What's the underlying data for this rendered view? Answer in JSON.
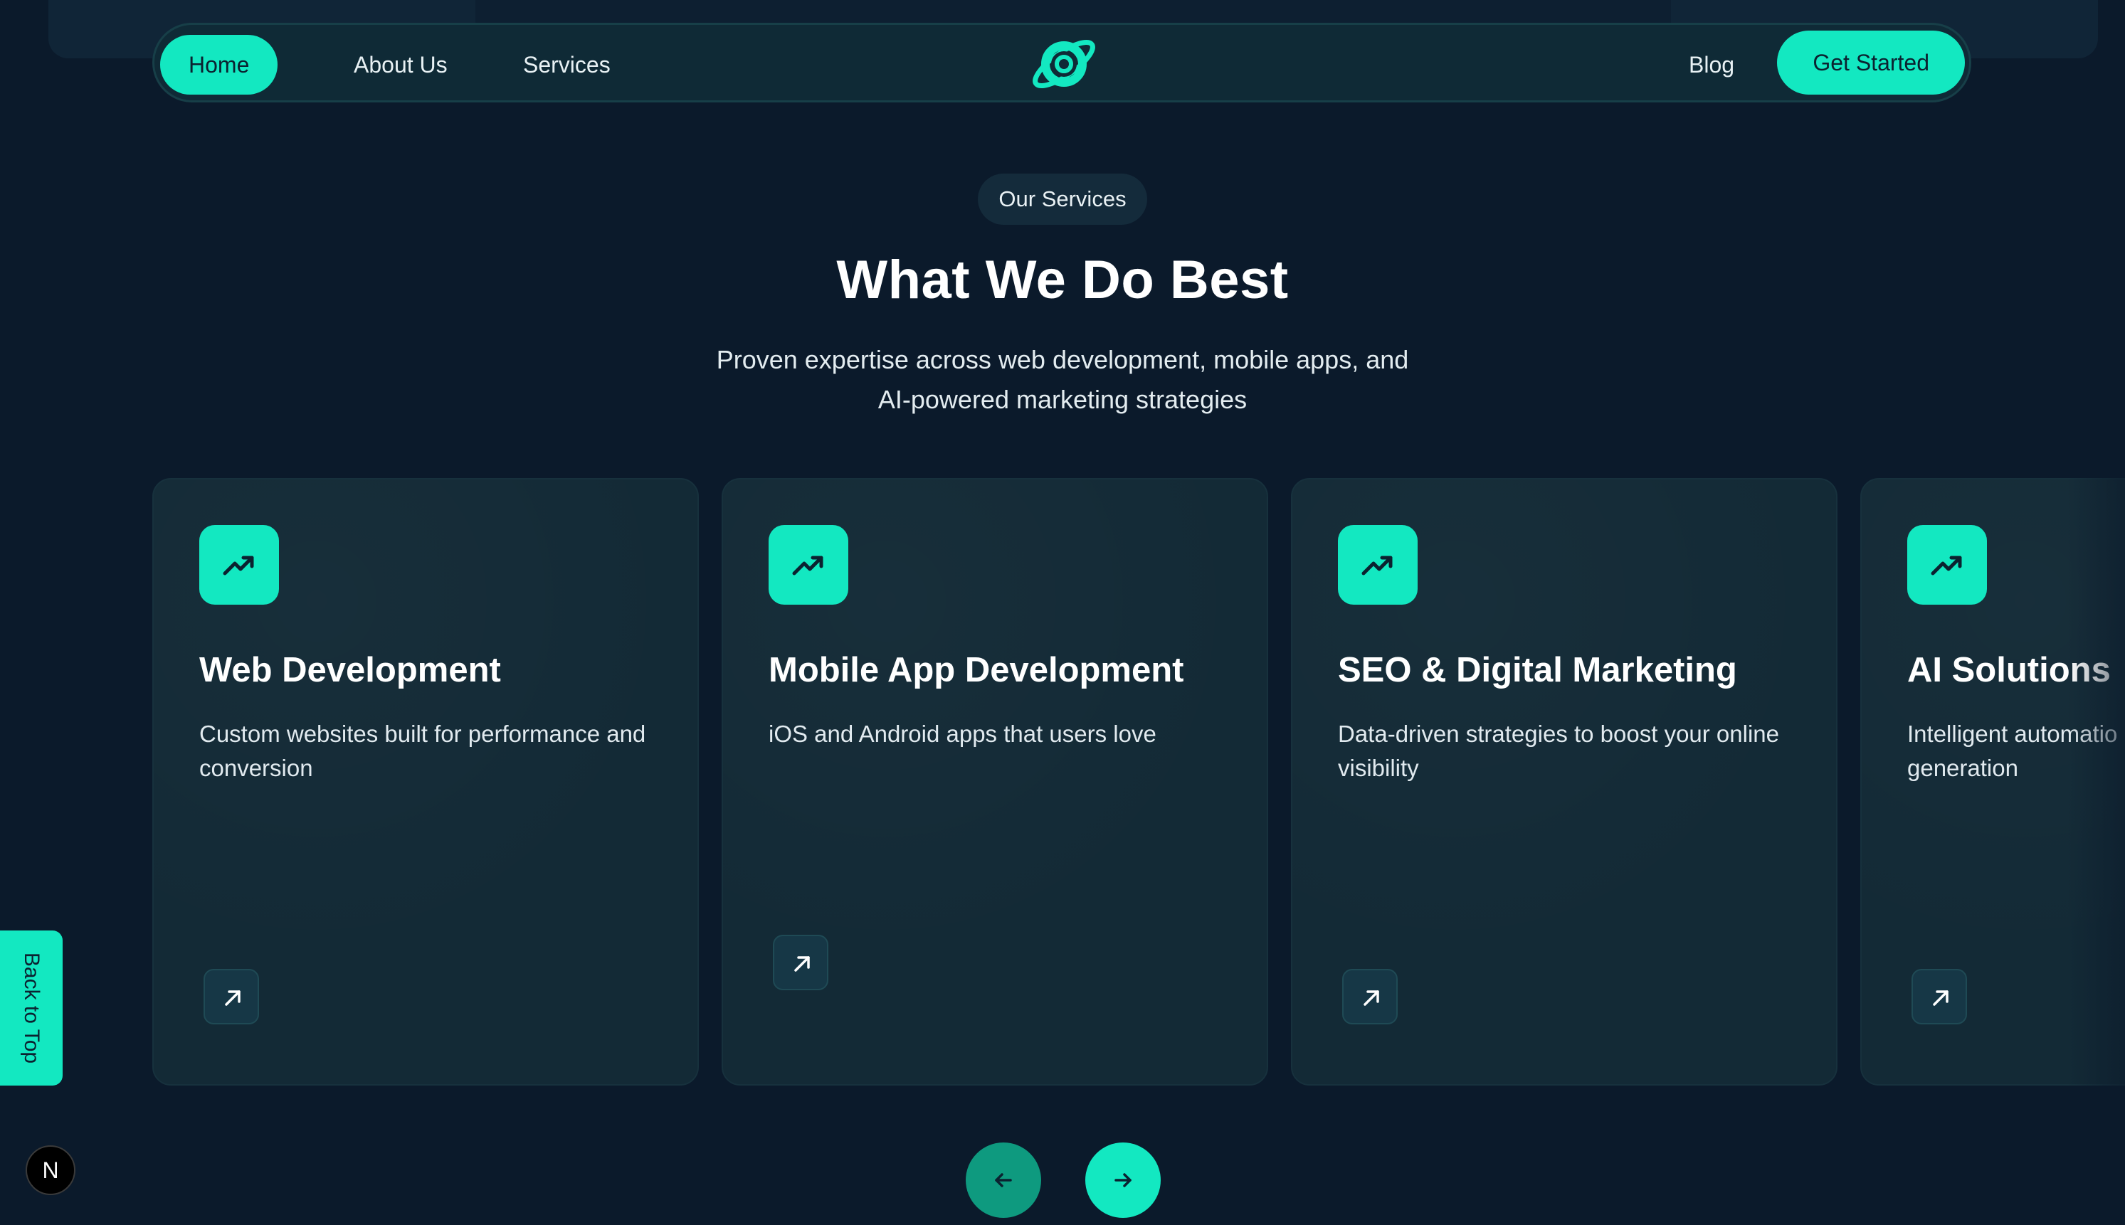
{
  "nav": {
    "items": [
      {
        "label": "Home",
        "active": true
      },
      {
        "label": "About Us",
        "active": false
      },
      {
        "label": "Services",
        "active": false
      },
      {
        "label": "Blog",
        "active": false
      }
    ],
    "cta_label": "Get Started",
    "logo_icon": "planet-logo-icon"
  },
  "header": {
    "eyebrow": "Our Services",
    "title": "What We Do Best",
    "subtitle_line1": "Proven expertise across web development, mobile apps, and",
    "subtitle_line2": "AI-powered marketing strategies"
  },
  "services": [
    {
      "title": "Web Development",
      "description": "Custom websites built for performance and conversion",
      "icon": "trending-up-icon",
      "link_icon": "arrow-up-right-icon"
    },
    {
      "title": "Mobile App Development",
      "description": "iOS and Android apps that users love",
      "icon": "trending-up-icon",
      "link_icon": "arrow-up-right-icon"
    },
    {
      "title": "SEO & Digital Marketing",
      "description": "Data-driven strategies to boost your online visibility",
      "icon": "trending-up-icon",
      "link_icon": "arrow-up-right-icon"
    },
    {
      "title": "AI Solutions",
      "description": "Intelligent automatio generation",
      "icon": "trending-up-icon",
      "link_icon": "arrow-up-right-icon"
    }
  ],
  "back_to_top": "Back to Top",
  "badge": "N",
  "carousel": {
    "prev_icon": "arrow-left-icon",
    "next_icon": "arrow-right-icon"
  },
  "colors": {
    "background": "#0b1a2b",
    "accent": "#13e8c1",
    "card": "#132a36",
    "accent_dark": "#0e9a7f"
  }
}
